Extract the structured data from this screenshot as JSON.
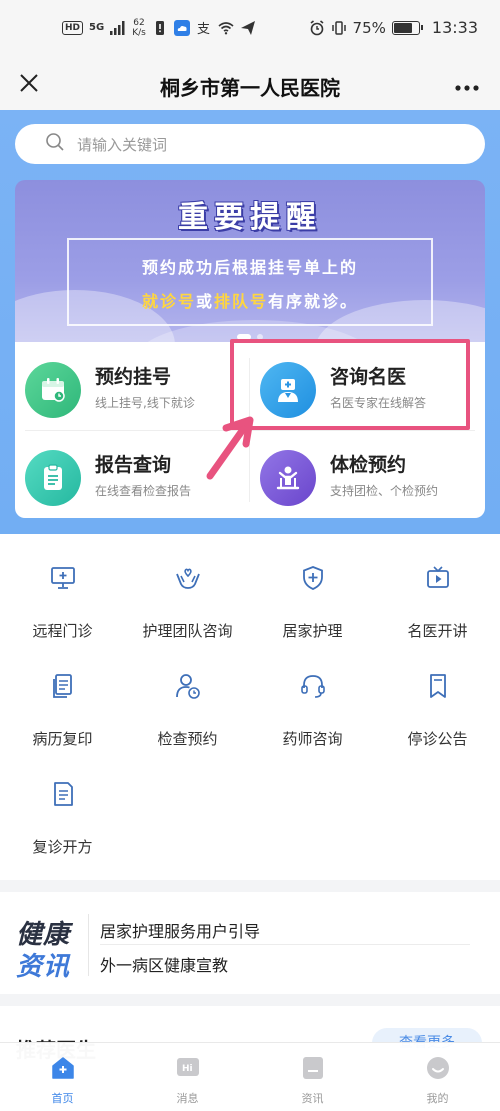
{
  "status_bar": {
    "hd": "HD",
    "signal": "5G",
    "speed_value": "62",
    "speed_unit": "K/s",
    "battery": "75%",
    "battery_level": 0.75,
    "time": "13:33"
  },
  "title_bar": {
    "title": "桐乡市第一人民医院",
    "close_icon": "close-icon",
    "more_icon": "more-icon"
  },
  "search": {
    "placeholder": "请输入关键词"
  },
  "banner": {
    "title": "重要提醒",
    "line1": "预约成功后根据挂号单上的",
    "line2_highlight1": "就诊号",
    "line2_mid": "或",
    "line2_highlight2": "排队号",
    "line2_end": "有序就诊。"
  },
  "services": [
    {
      "title": "预约挂号",
      "subtitle": "线上挂号,线下就诊",
      "icon": "calendar-icon",
      "color": "#3ec38a"
    },
    {
      "title": "咨询名医",
      "subtitle": "名医专家在线解答",
      "icon": "doctor-icon",
      "color": "#2f9ee8"
    },
    {
      "title": "报告查询",
      "subtitle": "在线查看检查报告",
      "icon": "report-icon",
      "color": "#33c9b0"
    },
    {
      "title": "体检预约",
      "subtitle": "支持团检、个检预约",
      "icon": "checkup-icon",
      "color": "#7c5ad8"
    }
  ],
  "grid": [
    {
      "label": "远程门诊",
      "icon": "monitor-icon"
    },
    {
      "label": "护理团队咨询",
      "icon": "care-hands-icon"
    },
    {
      "label": "居家护理",
      "icon": "shield-plus-icon"
    },
    {
      "label": "名医开讲",
      "icon": "video-play-icon"
    },
    {
      "label": "病历复印",
      "icon": "copy-doc-icon"
    },
    {
      "label": "检查预约",
      "icon": "person-clock-icon"
    },
    {
      "label": "药师咨询",
      "icon": "headset-icon"
    },
    {
      "label": "停诊公告",
      "icon": "bookmark-icon"
    },
    {
      "label": "复诊开方",
      "icon": "prescription-icon"
    }
  ],
  "news": {
    "logo_line1": "健康",
    "logo_line2": "资讯",
    "items": [
      "居家护理服务用户引导",
      "外一病区健康宣教"
    ]
  },
  "doctors": {
    "title": "推荐医生",
    "more": "查看更多"
  },
  "bottom_nav": [
    {
      "label": "首页",
      "icon": "home-icon",
      "active": true
    },
    {
      "label": "消息",
      "icon": "message-icon",
      "active": false
    },
    {
      "label": "资讯",
      "icon": "news-icon",
      "active": false
    },
    {
      "label": "我的",
      "icon": "profile-icon",
      "active": false
    }
  ],
  "colors": {
    "accent": "#3d86e8",
    "hero_bg": "#7bb3f5",
    "highlight": "#e8537f"
  }
}
